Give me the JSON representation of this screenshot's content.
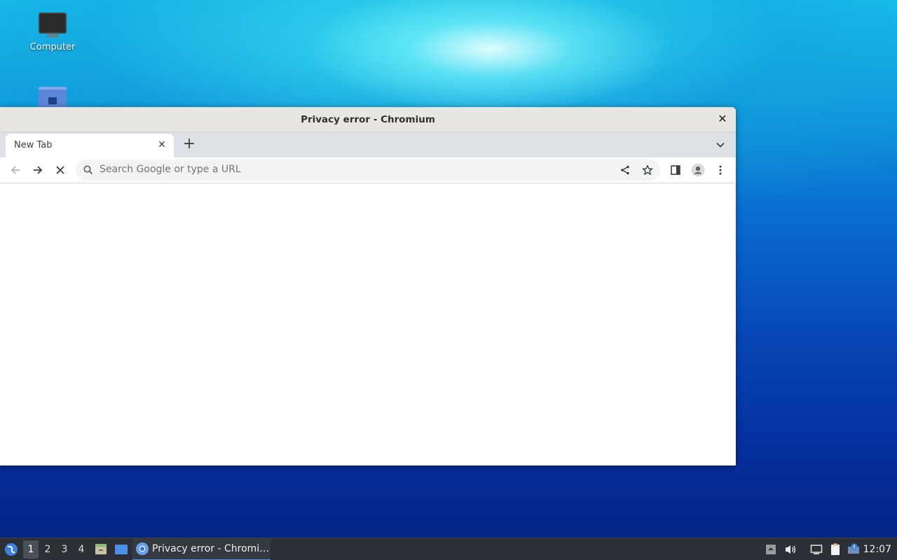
{
  "desktop": {
    "icons": [
      {
        "label": "Computer",
        "icon": "computer-icon"
      },
      {
        "label": "",
        "icon": "home-folder-icon"
      }
    ]
  },
  "window": {
    "title": "Privacy error - Chromium",
    "tabs": [
      {
        "label": "New Tab"
      }
    ],
    "omnibox": {
      "placeholder": "Search Google or type a URL",
      "value": ""
    }
  },
  "taskbar": {
    "workspaces": [
      "1",
      "2",
      "3",
      "4"
    ],
    "active_workspace": "1",
    "task_label": "Privacy error - Chromi…",
    "clock": "12:07"
  },
  "colors": {
    "tab_strip": "#dee1e6",
    "omnibox_bg": "#f1f3f4",
    "taskbar_bg": "#2c3036",
    "task_underline": "#4f8fe8"
  }
}
